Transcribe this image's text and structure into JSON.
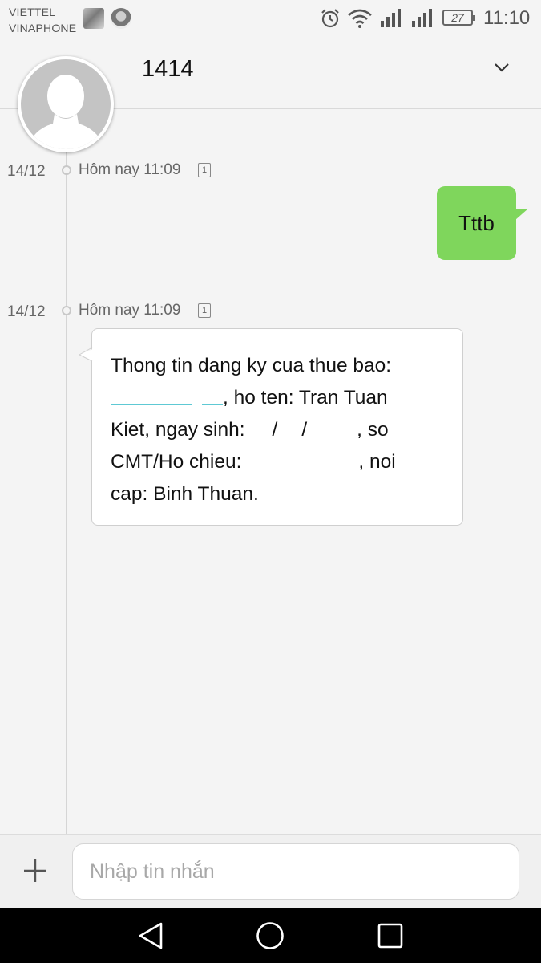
{
  "status_bar": {
    "carrier_1": "VIETTEL",
    "carrier_2": "VINAPHONE",
    "battery": "27",
    "time": "11:10",
    "icons": [
      "alarm-icon",
      "wifi-icon",
      "signal-icon",
      "signal-icon",
      "battery-icon"
    ]
  },
  "header": {
    "title": "1414",
    "menu_icon": "chevron-down-icon"
  },
  "messages": [
    {
      "direction": "sent",
      "date": "14/12",
      "time": "Hôm nay 11:09",
      "sim": "1",
      "text": "Tttb"
    },
    {
      "direction": "received",
      "date": "14/12",
      "time": "Hôm nay 11:09",
      "sim": "1",
      "lines": [
        "Thong tin dang ky cua thue bao:",
        ", ho ten: Tran Tuan",
        "Kiet, ngay sinh:",
        "/",
        "/",
        ", so",
        "CMT/Ho chieu:",
        ",  noi",
        "cap: Binh Thuan."
      ]
    }
  ],
  "composer": {
    "placeholder": "Nhập tin nhắn",
    "add_icon": "plus-icon"
  },
  "nav": {
    "icons": [
      "back-icon",
      "home-icon",
      "recents-icon"
    ]
  },
  "colors": {
    "background": "#f4f4f4",
    "sent_bubble": "#7fd65c",
    "received_bubble": "#ffffff",
    "redaction_line": "#5ec9d4",
    "nav_bar": "#000000"
  }
}
